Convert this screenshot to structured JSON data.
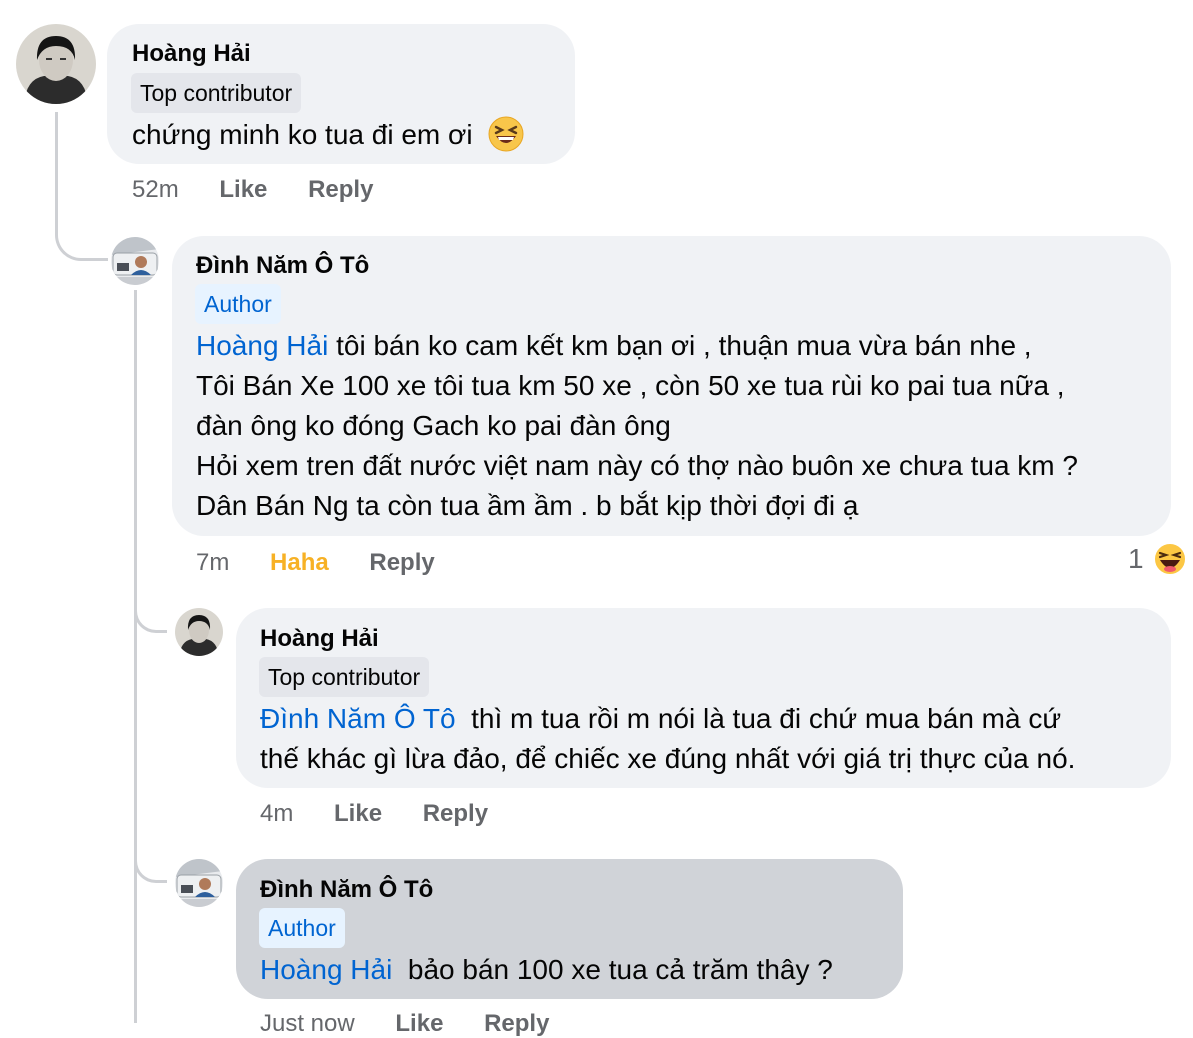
{
  "comments": [
    {
      "author": "Hoàng Hải",
      "badge": "Top contributor",
      "lines": [
        "chứng minh ko tua đi em ơi"
      ],
      "time": "52m",
      "like": "Like",
      "reply": "Reply"
    },
    {
      "author": "Đình Năm Ô Tô",
      "badge": "Author",
      "mention": "Hoàng Hải",
      "first_line": " tôi bán ko cam kết km bạn ơi , thuận mua vừa bán nhe ,",
      "lines": [
        "Tôi Bán Xe 100 xe tôi tua km 50 xe , còn 50 xe tua rùi ko pai tua nữa ,",
        "đàn ông ko đóng Gach ko pai đàn ông",
        "Hỏi xem tren đất nước việt nam này có thợ nào buôn xe chưa tua km ?",
        "Dân Bán Ng ta còn tua ầm ầm . b bắt kịp thời đợi đi ạ"
      ],
      "time": "7m",
      "reaction_label": "Haha",
      "reply": "Reply",
      "reaction_count": "1"
    },
    {
      "author": "Hoàng Hải",
      "badge": "Top contributor",
      "mention": "Đình Năm Ô Tô",
      "first_line": "  thì m tua rồi m nói là tua đi chứ mua bán mà cứ",
      "lines": [
        "thế khác gì lừa đảo, để chiếc xe đúng nhất với giá trị thực của nó."
      ],
      "time": "4m",
      "like": "Like",
      "reply": "Reply"
    },
    {
      "author": "Đình Năm Ô Tô",
      "badge": "Author",
      "mention": "Hoàng Hải",
      "first_line": "  bảo bán 100 xe tua cả trăm thây ?",
      "time": "Just now",
      "like": "Like",
      "reply": "Reply"
    }
  ],
  "colors": {
    "bubble": "#f0f2f5",
    "selected_bubble": "#d0d3d8",
    "mention": "#0064d1",
    "haha": "#f7b125",
    "meta": "#65676b"
  },
  "icons": {
    "laughing_emoji": "grinning-squinting-face-icon",
    "haha_reaction": "haha-reaction-icon"
  }
}
